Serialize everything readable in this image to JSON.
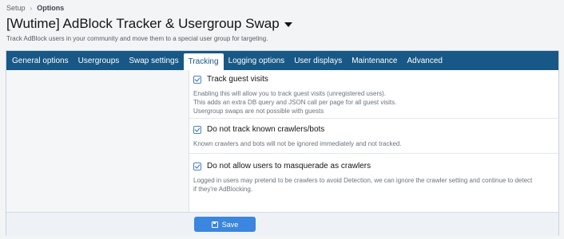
{
  "breadcrumb": {
    "items": [
      "Setup",
      "Options"
    ],
    "separator": "›"
  },
  "page": {
    "title": "[Wutime] AdBlock Tracker & Usergroup Swap",
    "description": "Track AdBlock users in your community and move them to a special user group for targeting."
  },
  "tabs": [
    {
      "label": "General options",
      "active": false
    },
    {
      "label": "Usergroups",
      "active": false
    },
    {
      "label": "Swap settings",
      "active": false
    },
    {
      "label": "Tracking",
      "active": true
    },
    {
      "label": "Logging options",
      "active": false
    },
    {
      "label": "User displays",
      "active": false
    },
    {
      "label": "Maintenance",
      "active": false
    },
    {
      "label": "Advanced",
      "active": false
    }
  ],
  "options": [
    {
      "label": "Track guest visits",
      "checked": true,
      "hints": [
        "Enabling this will allow you to track guest visits (unregistered users).",
        "This adds an extra DB query and JSON call per page for all guest visits.",
        "Usergroup swaps are not possible with guests"
      ]
    },
    {
      "label": "Do not track known crawlers/bots",
      "checked": true,
      "hints": [
        "Known crawlers and bots will not be ignored immediately and not tracked."
      ]
    },
    {
      "label": "Do not allow users to masquerade as crawlers",
      "checked": true,
      "hints": [
        "Logged in users may pretend to be crawlers to avoid Detection, we can ignore the crawler setting and continue to detect",
        "if they're AdBlocking."
      ]
    }
  ],
  "footer": {
    "save_label": "Save"
  },
  "colors": {
    "tab_bar": "#185886",
    "save_button": "#3b86de",
    "checkbox_accent": "#2f6cb5"
  }
}
